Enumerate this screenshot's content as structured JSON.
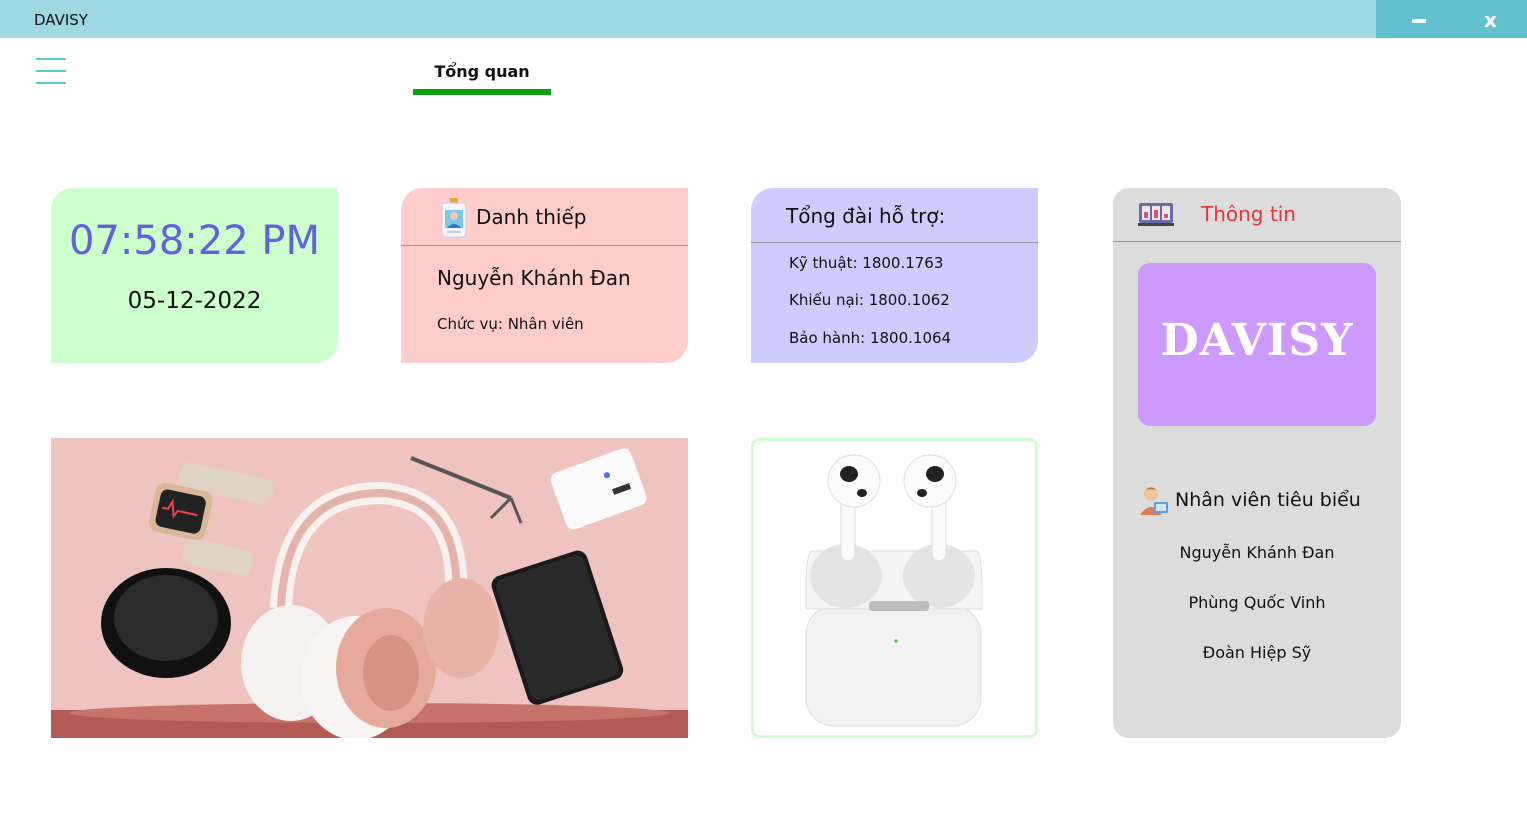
{
  "window": {
    "title": "DAVISY",
    "minimize_icon": "minimize-icon",
    "close_label": "x"
  },
  "nav": {
    "menu_icon": "hamburger-menu-icon",
    "tab_label": "Tổng quan",
    "tab_active_color": "#0ea20e"
  },
  "clock_card": {
    "time": "07:58:22 PM",
    "date": "05-12-2022",
    "bg": "#ccffcc"
  },
  "business_card": {
    "header": "Danh thiếp",
    "icon": "id-badge-icon",
    "name": "Nguyễn Khánh Đan",
    "role": "Chức vụ: Nhân viên",
    "bg": "#ffcccc"
  },
  "hotline_card": {
    "header": "Tổng đài hỗ trợ:",
    "lines": [
      "Kỹ thuật: 1800.1763",
      "Khiếu nại: 1800.1062",
      "Bảo hành: 1800.1064"
    ],
    "bg": "#ccccff"
  },
  "banner": {
    "image": "tech-accessories-banner-image"
  },
  "product": {
    "image": "wireless-earbuds-image"
  },
  "info_panel": {
    "header": "Thông tin",
    "icon": "info-dashboard-icon",
    "brand": "DAVISY",
    "brand_bg": "#cc99ff",
    "staff_title": "Nhân viên tiêu biểu",
    "staff_icon": "employee-icon",
    "staff": [
      "Nguyễn Khánh Đan",
      "Phùng Quốc Vinh",
      "Đoàn Hiệp Sỹ"
    ]
  }
}
